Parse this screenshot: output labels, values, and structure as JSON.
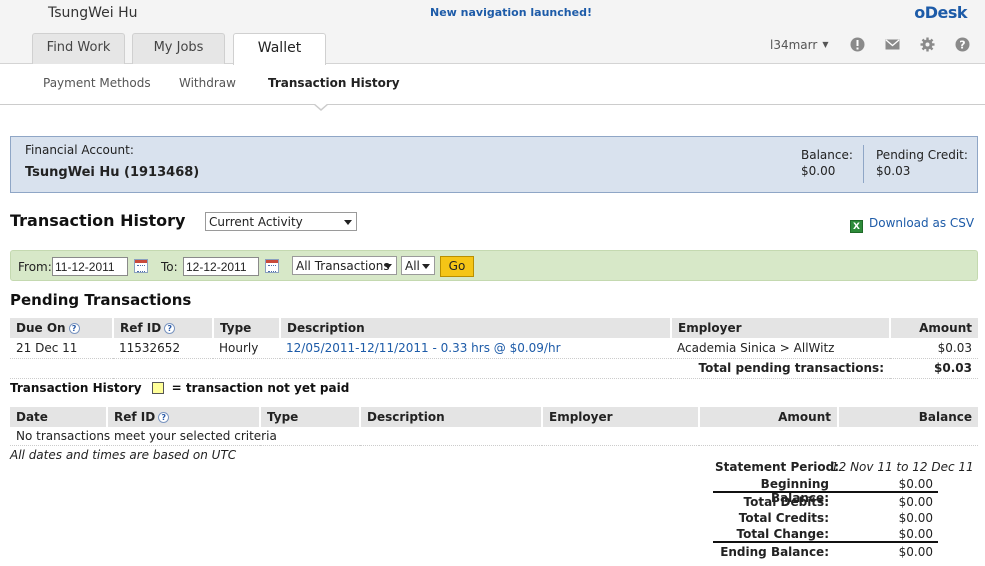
{
  "header": {
    "user_name": "TsungWei Hu",
    "notice": "New navigation launched!",
    "logo": "oDesk",
    "username_menu": "l34marr"
  },
  "tabs": [
    {
      "label": "Find Work",
      "active": false
    },
    {
      "label": "My Jobs",
      "active": false
    },
    {
      "label": "Wallet",
      "active": true
    }
  ],
  "icons": [
    "alert-icon",
    "mail-icon",
    "gear-icon",
    "help-icon"
  ],
  "subnav": [
    {
      "label": "Payment Methods",
      "active": false
    },
    {
      "label": "Withdraw",
      "active": false
    },
    {
      "label": "Transaction History",
      "active": true
    }
  ],
  "account": {
    "label": "Financial Account:",
    "name": "TsungWei Hu (1913468)",
    "balance_label": "Balance:",
    "balance_value": "$0.00",
    "pending_label": "Pending Credit:",
    "pending_value": "$0.03"
  },
  "history": {
    "title": "Transaction History",
    "view_select": "Current Activity",
    "csv_label": "Download as CSV"
  },
  "filter": {
    "from_label": "From:",
    "from_value": "11-12-2011",
    "to_label": "To:",
    "to_value": "12-12-2011",
    "type_select": "All Transactions",
    "all_select": "All",
    "go_label": "Go"
  },
  "pending": {
    "title": "Pending Transactions",
    "columns": [
      "Due On",
      "Ref ID",
      "Type",
      "Description",
      "Employer",
      "Amount"
    ],
    "rows": [
      {
        "due": "21 Dec 11",
        "ref": "11532652",
        "type": "Hourly",
        "description": "12/05/2011-12/11/2011 - 0.33 hrs @ $0.09/hr",
        "employer": "Academia Sinica > AllWitz",
        "amount": "$0.03"
      }
    ],
    "total_label": "Total pending transactions:",
    "total_value": "$0.03"
  },
  "legend": {
    "title": "Transaction History",
    "text": "= transaction not yet paid"
  },
  "transactions": {
    "columns": [
      "Date",
      "Ref ID",
      "Type",
      "Description",
      "Employer",
      "Amount",
      "Balance"
    ],
    "empty_message": "No transactions meet your selected criteria"
  },
  "utc_note": "All dates and times are based on UTC",
  "statement": {
    "period_label": "Statement Period:",
    "period_value": "12 Nov 11 to 12 Dec 11",
    "beginning_label": "Beginning Balance:",
    "beginning_value": "$0.00",
    "debits_label": "Total Debits:",
    "debits_value": "$0.00",
    "credits_label": "Total Credits:",
    "credits_value": "$0.00",
    "change_label": "Total Change:",
    "change_value": "$0.00",
    "ending_label": "Ending Balance:",
    "ending_value": "$0.00"
  }
}
